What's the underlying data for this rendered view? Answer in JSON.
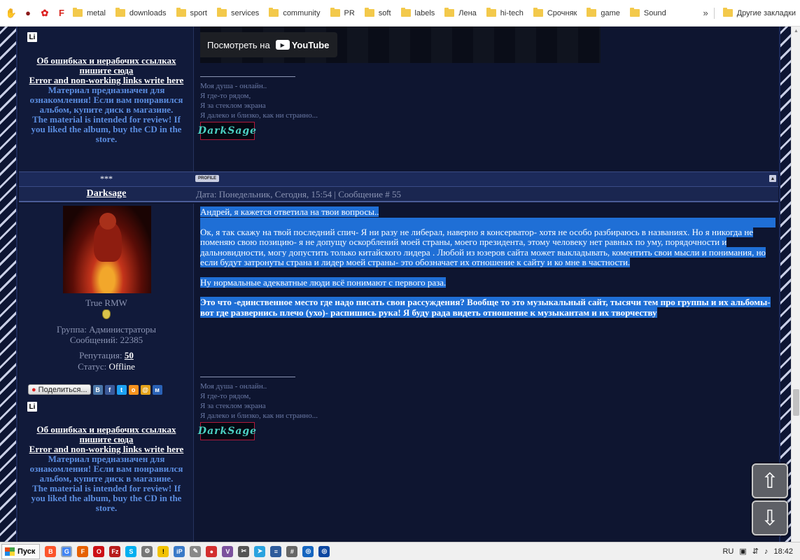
{
  "bookmarks": {
    "items": [
      "metal",
      "downloads",
      "sport",
      "services",
      "community",
      "PR",
      "soft",
      "labels",
      "Лена",
      "hi-tech",
      "Срочняк",
      "game",
      "Sound"
    ],
    "more": "»",
    "other": "Другие закладки"
  },
  "top_post": {
    "video_watch_label": "Посмотреть на",
    "video_brand": "YouTube",
    "sidebar": {
      "errors_link": "Об ошибках и нерабочих ссылках пишите сюда",
      "errors_link_en": "Error and non-working links write here",
      "notice_ru": "Материал предназначен для ознакомления! Если вам понравился альбом, купите диск в магазине.",
      "notice_en": "The material is intended for review! If you liked the album, buy the CD in the store."
    },
    "signature": [
      "Моя душа - онлайн..",
      "Я где-то рядом,",
      "Я за стеклом экрана",
      "Я далеко и близко, как ни странно..."
    ],
    "sig_logo": "DarkSage"
  },
  "separator": {
    "stars": "***",
    "profile_label": "PROFILE"
  },
  "post": {
    "author": "Darksage",
    "header": "Дата: Понедельник, Сегодня, 15:54 | Сообщение # 55",
    "rank": "True RMW",
    "group": "Группа: Администраторы",
    "messages": "Сообщений: 22385",
    "reputation_label": "Репутация:",
    "reputation_value": "50",
    "status_label": "Статус:",
    "status_value": "Offline",
    "share_label": "Поделиться...",
    "share_icons": [
      "В",
      "f",
      "t",
      "о",
      "@",
      "м"
    ],
    "body": {
      "p1": "Андрей, я кажется ответила на твои вопросы..",
      "p2": "Ок, я так скажу на твой последний спич- Я ни разу не либерал, наверно я консерватор- хотя не особо разбираюсь в названиях. Но я никогда не поменяю свою позицию- я не допущу оскорблений моей страны, моего президента, этому человеку нет равных по уму, порядочности и дальновидности, могу допустить только китайского лидера . Любой из юзеров сайта может выкладывать, коментить  свои мысли и понимания, но если будут затронуты страна и лидер моей страны- это обозначает их отношение к сайту и ко мне в частности.",
      "p3": "Ну нормальные адекватные люди всё понимают с первого раза.",
      "p4": "Это что -единственное место где надо писать свои рассуждения? Вообще то это музыкальный сайт, тысячи тем про группы и их альбомы- вот где  развернись плечо (ухо)- распишись рука! Я буду рада видеть отношение к музыкантам и их творчеству"
    },
    "signature": [
      "Моя душа - онлайн..",
      "Я где-то рядом,",
      "Я за стеклом экрана",
      "Я далеко и близко, как ни странно..."
    ],
    "sig_logo": "DarkSage",
    "sidebar": {
      "errors_link": "Об ошибках и нерабочих ссылках пишите сюда",
      "errors_link_en": "Error and non-working links write here",
      "notice_ru": "Материал предназначен для ознакомления! Если вам понравился альбом, купите диск в магазине.",
      "notice_en": "The material is intended for review! If you liked the album, buy the CD in the store."
    }
  },
  "floating": {
    "up": "⇧",
    "down": "⇩"
  },
  "taskbar": {
    "start_label": "Пуск",
    "lang": "RU",
    "time": "18:42"
  },
  "colors": {
    "page_bg": "#0e1530",
    "link_blue": "#5b8de0",
    "selection": "#1f6fd6"
  }
}
